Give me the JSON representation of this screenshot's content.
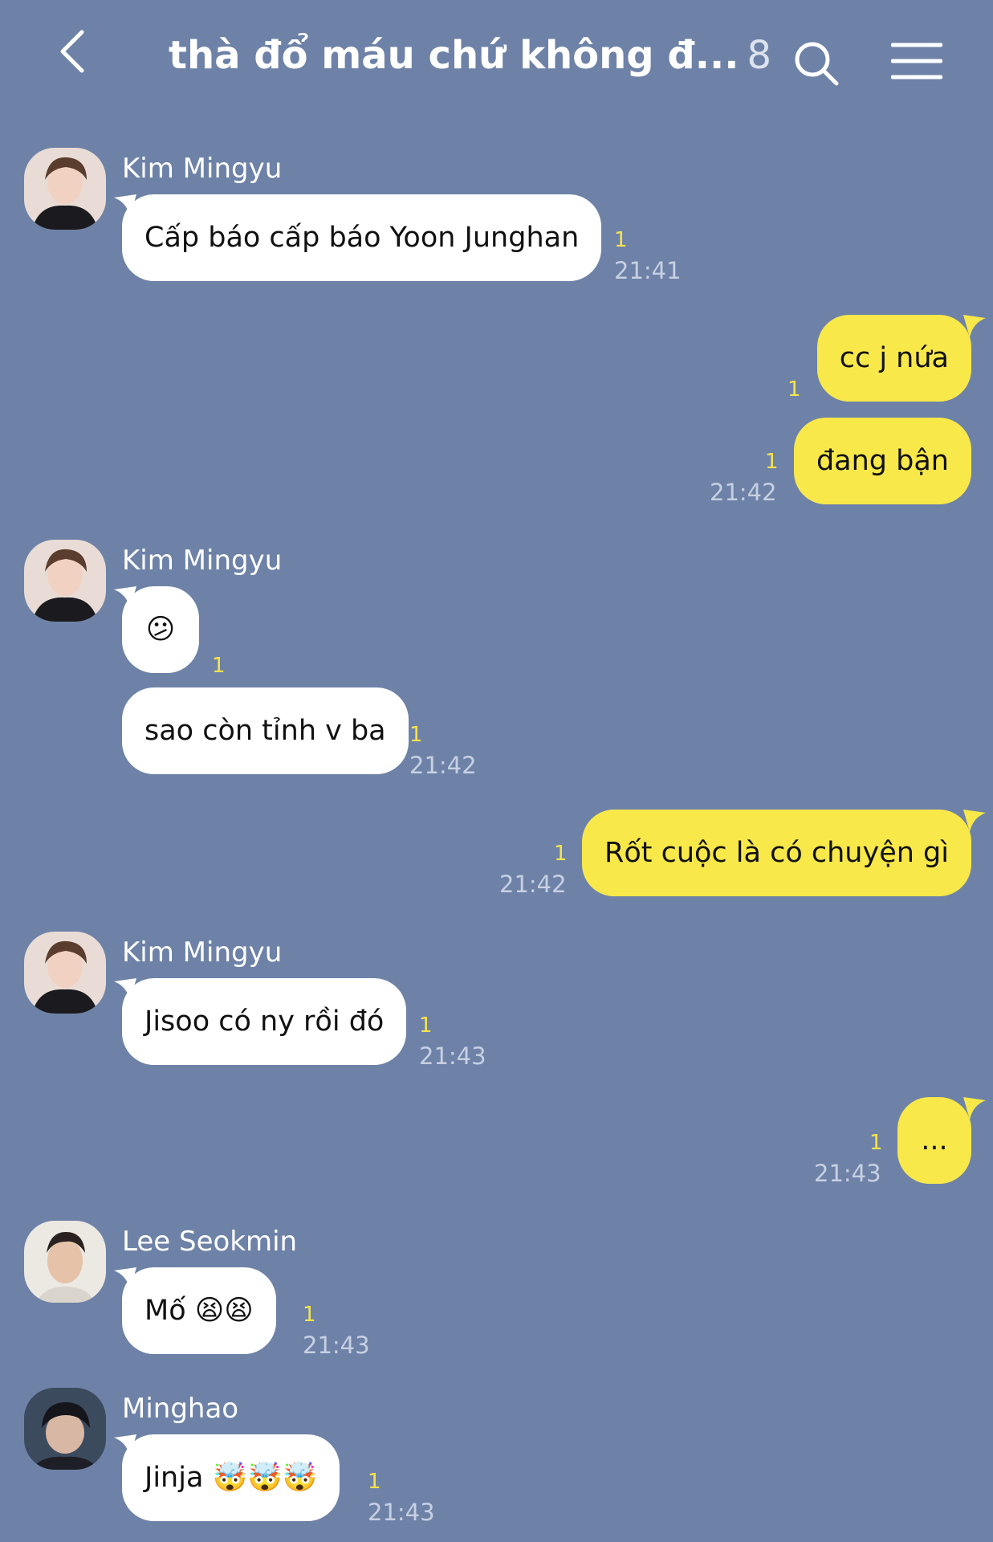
{
  "header": {
    "title": "thà đổ máu chứ không đ...",
    "member_count": "8",
    "back_icon": "chevron-left-icon",
    "search_icon": "search-icon",
    "menu_icon": "hamburger-menu-icon"
  },
  "colors": {
    "background": "#6e82a8",
    "incoming_bubble": "#ffffff",
    "outgoing_bubble": "#f8e84a",
    "unread": "#f6e34b"
  },
  "messages": [
    {
      "sender": "Kim Mingyu",
      "text": "Cấp báo cấp báo Yoon Junghan",
      "unread": "1",
      "time": "21:41"
    },
    {
      "text": "cc j nứa",
      "unread": "1"
    },
    {
      "text": "đang bận",
      "unread": "1",
      "time": "21:42"
    },
    {
      "sender": "Kim Mingyu",
      "text": "😕",
      "unread": "1"
    },
    {
      "text": "sao còn tỉnh v ba",
      "unread": "1",
      "time": "21:42"
    },
    {
      "text": "Rốt cuộc là có chuyện gì",
      "unread": "1",
      "time": "21:42"
    },
    {
      "sender": "Kim Mingyu",
      "text": "Jisoo có ny rồi đó",
      "unread": "1",
      "time": "21:43"
    },
    {
      "text": "...",
      "unread": "1",
      "time": "21:43"
    },
    {
      "sender": "Lee Seokmin",
      "text": "Mố 😫😫",
      "unread": "1",
      "time": "21:43"
    },
    {
      "sender": "Minghao",
      "text": "Jinja 🤯🤯🤯",
      "unread": "1",
      "time": "21:43"
    }
  ]
}
